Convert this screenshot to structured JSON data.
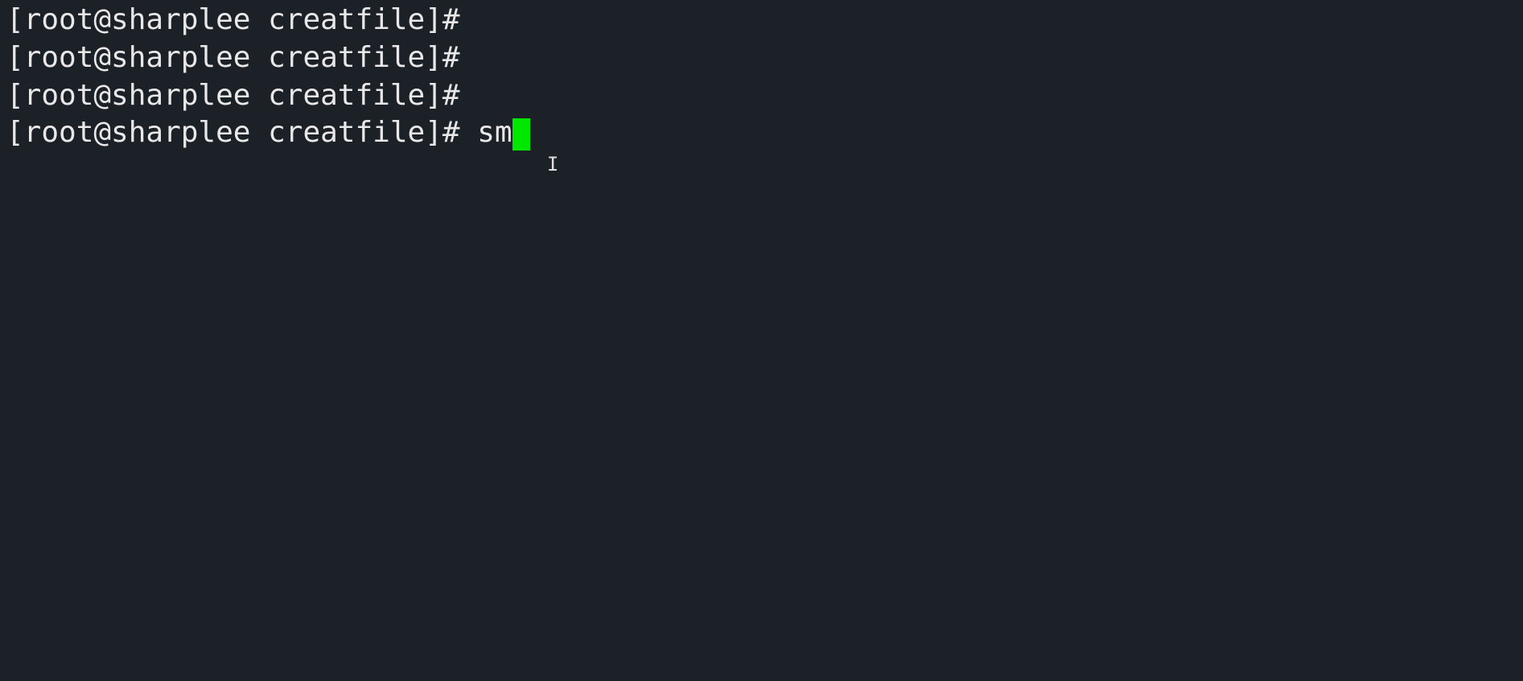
{
  "terminal": {
    "prompt": "[root@sharplee creatfile]#",
    "lines": [
      {
        "prompt": "[root@sharplee creatfile]#",
        "command": ""
      },
      {
        "prompt": "[root@sharplee creatfile]#",
        "command": ""
      },
      {
        "prompt": "[root@sharplee creatfile]#",
        "command": ""
      },
      {
        "prompt": "[root@sharplee creatfile]#",
        "command": "sm"
      }
    ],
    "cursor_visible": true
  }
}
